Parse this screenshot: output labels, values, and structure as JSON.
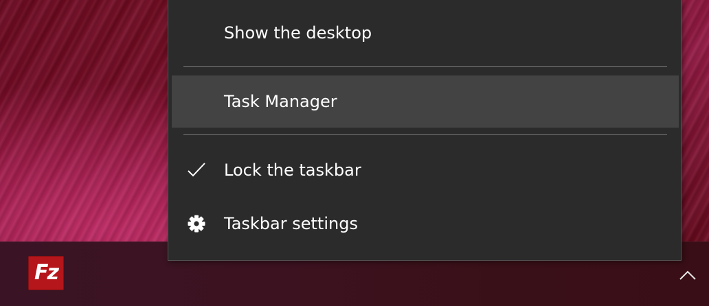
{
  "context_menu": {
    "items": [
      {
        "label": "Show the desktop"
      },
      {
        "label": "Task Manager"
      },
      {
        "label": "Lock the taskbar",
        "checked": true,
        "icon": "checkmark-icon"
      },
      {
        "label": "Taskbar settings",
        "icon": "gear-icon"
      }
    ]
  },
  "taskbar": {
    "pinned_apps": [
      {
        "icon": "filezilla-icon",
        "glyph": "Fz",
        "color": "#b5161b"
      }
    ],
    "tray": {
      "icon": "chevron-up-icon"
    }
  },
  "colors": {
    "menu_background": "#2b2b2b",
    "menu_highlight": "#434343",
    "menu_text": "#ffffff"
  }
}
